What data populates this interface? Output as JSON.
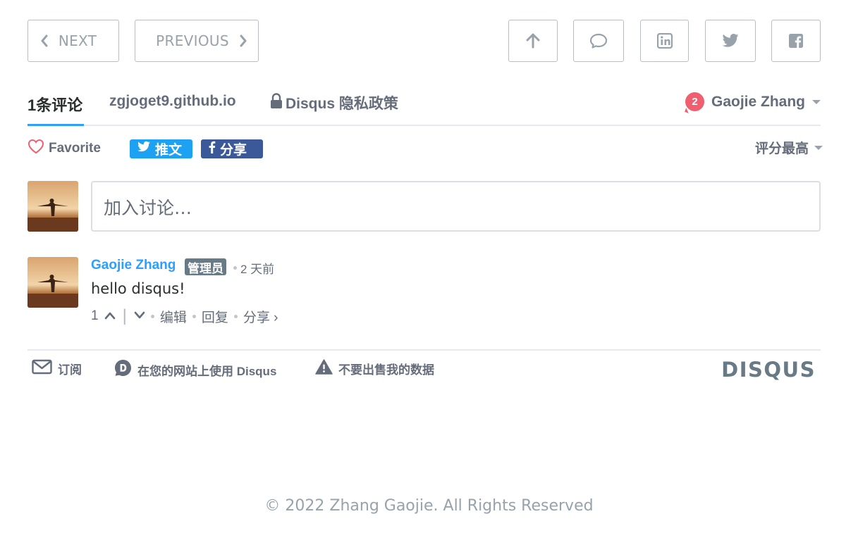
{
  "nav": {
    "next_label": "NEXT",
    "previous_label": "PREVIOUS"
  },
  "share_icons": [
    "arrow-up-icon",
    "comment-icon",
    "linkedin-icon",
    "twitter-icon",
    "facebook-icon"
  ],
  "disqus": {
    "tabs": {
      "count": "1条评论",
      "site": "zgjoget9.github.io",
      "privacy": "Disqus 隐私政策"
    },
    "user": {
      "notifications": "2",
      "name": "Gaojie Zhang"
    },
    "toolbar": {
      "favorite": "Favorite",
      "tweet": "推文",
      "share": "分享",
      "sort": "评分最高"
    },
    "composer": {
      "placeholder": "加入讨论…"
    },
    "comment": {
      "author": "Gaojie Zhang",
      "badge": "管理员",
      "time": "2 天前",
      "text": "hello disqus!",
      "votes": "1",
      "edit": "编辑",
      "reply": "回复",
      "share": "分享 ›"
    },
    "footer": {
      "subscribe": "订阅",
      "use_disqus": "在您的网站上使用 Disqus",
      "do_not_sell": "不要出售我的数据",
      "logo": "DISQUS"
    },
    "colors": {
      "accent": "#2e9fff",
      "notification": "#f05f70",
      "twitter": "#1da1f2",
      "facebook": "#3b5998",
      "text_muted": "#656c7a"
    }
  },
  "footer": {
    "copyright": "© 2022 Zhang Gaojie. All Rights Reserved"
  }
}
